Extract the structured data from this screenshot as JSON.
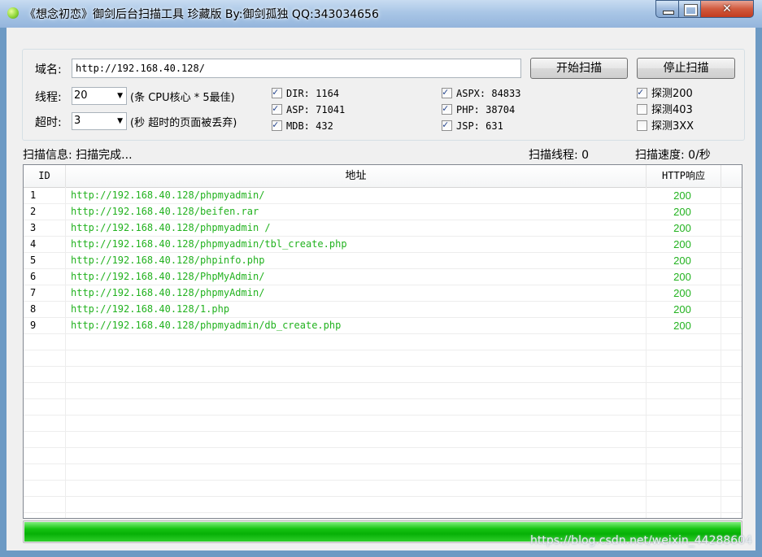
{
  "window": {
    "title": "《想念初恋》御剑后台扫描工具 珍藏版 By:御剑孤独 QQ:343034656"
  },
  "form": {
    "domain_label": "域名:",
    "domain_value": "http://192.168.40.128/",
    "start_button": "开始扫描",
    "stop_button": "停止扫描",
    "threads_label": "线程:",
    "threads_value": "20",
    "threads_hint": "(条 CPU核心 * 5最佳)",
    "timeout_label": "超时:",
    "timeout_value": "3",
    "timeout_hint": "(秒 超时的页面被丢弃)"
  },
  "dictionaries": [
    {
      "label": "DIR: 1164",
      "checked": true
    },
    {
      "label": "ASP: 71041",
      "checked": true
    },
    {
      "label": "MDB: 432",
      "checked": true
    },
    {
      "label": "ASPX: 84833",
      "checked": true
    },
    {
      "label": "PHP: 38704",
      "checked": true
    },
    {
      "label": "JSP: 631",
      "checked": true
    }
  ],
  "probes": [
    {
      "label": "探测200",
      "checked": true
    },
    {
      "label": "探测403",
      "checked": false
    },
    {
      "label": "探测3XX",
      "checked": false
    }
  ],
  "status": {
    "info": "扫描信息: 扫描完成...",
    "threads": "扫描线程: 0",
    "speed": "扫描速度: 0/秒"
  },
  "table": {
    "headers": [
      "ID",
      "地址",
      "HTTP响应"
    ],
    "rows": [
      {
        "id": "1",
        "url": "http://192.168.40.128/phpmyadmin/",
        "code": "200"
      },
      {
        "id": "2",
        "url": "http://192.168.40.128/beifen.rar",
        "code": "200"
      },
      {
        "id": "3",
        "url": "http://192.168.40.128/phpmyadmin /",
        "code": "200"
      },
      {
        "id": "4",
        "url": "http://192.168.40.128/phpmyadmin/tbl_create.php",
        "code": "200"
      },
      {
        "id": "5",
        "url": "http://192.168.40.128/phpinfo.php",
        "code": "200"
      },
      {
        "id": "6",
        "url": "http://192.168.40.128/PhpMyAdmin/",
        "code": "200"
      },
      {
        "id": "7",
        "url": "http://192.168.40.128/phpmyAdmin/",
        "code": "200"
      },
      {
        "id": "8",
        "url": "http://192.168.40.128/1.php",
        "code": "200"
      },
      {
        "id": "9",
        "url": "http://192.168.40.128/phpmyadmin/db_create.php",
        "code": "200"
      }
    ]
  },
  "progress": {
    "fraction": 1.0,
    "color": "#16c413"
  },
  "colors": {
    "result_text": "#22b21f"
  },
  "watermark": "https://blog.csdn.net/weixin_44288604"
}
